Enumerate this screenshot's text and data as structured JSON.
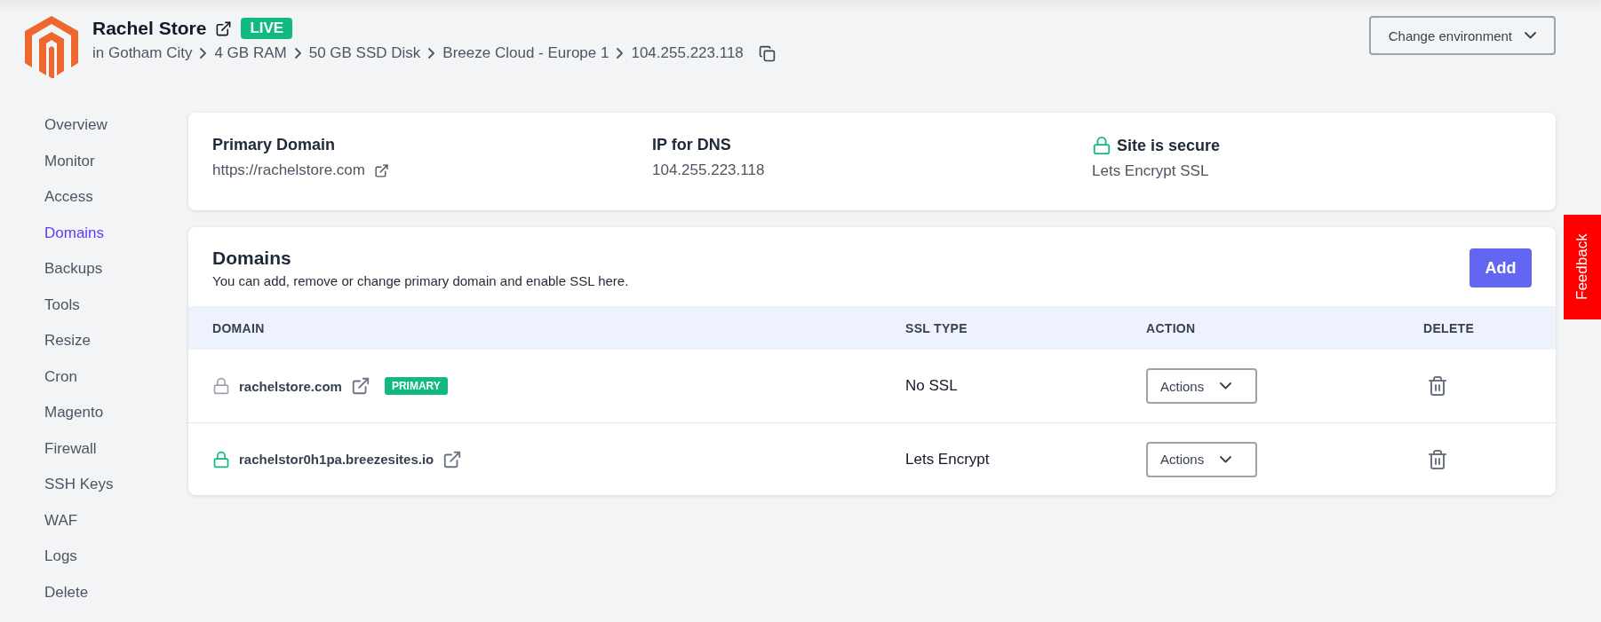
{
  "header": {
    "title": "Rachel Store",
    "status": "LIVE",
    "breadcrumb": [
      "in Gotham City",
      "4 GB RAM",
      "50 GB SSD Disk",
      "Breeze Cloud - Europe 1",
      "104.255.223.118"
    ],
    "environment_button": "Change environment"
  },
  "sidebar": {
    "items": [
      {
        "label": "Overview",
        "selected": false
      },
      {
        "label": "Monitor",
        "selected": false
      },
      {
        "label": "Access",
        "selected": false
      },
      {
        "label": "Domains",
        "selected": true
      },
      {
        "label": "Backups",
        "selected": false
      },
      {
        "label": "Tools",
        "selected": false
      },
      {
        "label": "Resize",
        "selected": false
      },
      {
        "label": "Cron",
        "selected": false
      },
      {
        "label": "Magento",
        "selected": false
      },
      {
        "label": "Firewall",
        "selected": false
      },
      {
        "label": "SSH Keys",
        "selected": false
      },
      {
        "label": "WAF",
        "selected": false
      },
      {
        "label": "Logs",
        "selected": false
      },
      {
        "label": "Delete",
        "selected": false
      }
    ]
  },
  "summary": [
    {
      "kind": "link",
      "heading": "Primary Domain",
      "value": "https://rachelstore.com"
    },
    {
      "kind": "plain",
      "heading": "IP for DNS",
      "value": "104.255.223.118"
    },
    {
      "kind": "secure",
      "heading": "Site is secure",
      "value": "Lets Encrypt SSL"
    }
  ],
  "domains": {
    "title": "Domains",
    "description": "You can add, remove or change primary domain and enable SSL here.",
    "add_button": "Add",
    "columns": [
      "DOMAIN",
      "SSL TYPE",
      "ACTION",
      "DELETE"
    ],
    "rows": [
      {
        "domain": "rachelstore.com",
        "secure": false,
        "badge": "PRIMARY",
        "ssl_type": "No SSL",
        "action": "Actions"
      },
      {
        "domain": "rachelstor0h1pa.breezesites.io",
        "secure": true,
        "ssl_type": "Lets Encrypt",
        "action": "Actions"
      }
    ]
  },
  "feedback": "Feedback"
}
